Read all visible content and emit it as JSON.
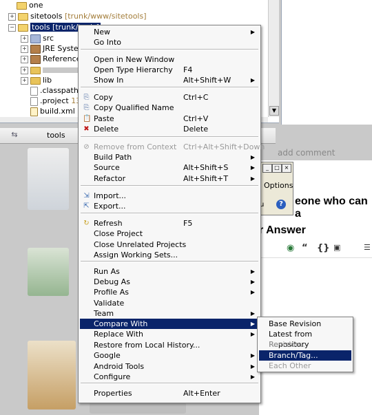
{
  "explorer": {
    "rows": [
      {
        "label": "one",
        "decor": ""
      },
      {
        "label": "sitetools",
        "decor": "[trunk/www/sitetools]"
      },
      {
        "label": "tools [trunk/tools]",
        "decor": ""
      },
      {
        "label": "src",
        "decor": ""
      },
      {
        "label": "JRE System",
        "decor": ""
      },
      {
        "label": "Referenced",
        "decor": ""
      },
      {
        "label": "",
        "decor": ""
      },
      {
        "label": "lib",
        "decor": ""
      },
      {
        "label": ".classpath",
        "decor": "1"
      },
      {
        "label": ".project",
        "decor": "132"
      },
      {
        "label": "build.xml",
        "decor": "14"
      }
    ]
  },
  "tabstrip": {
    "tab_label": "tools"
  },
  "web": {
    "add_comment": "add comment",
    "heading1": "eone who can a",
    "heading2": "r Answer",
    "dialog_options": "Options",
    "dialog_u": "u"
  },
  "menu": {
    "items": [
      {
        "label": "New",
        "shortcut": "",
        "submenu": true,
        "icon": ""
      },
      {
        "label": "Go Into",
        "shortcut": "",
        "submenu": false,
        "icon": ""
      },
      {
        "label": "Open in New Window",
        "shortcut": "",
        "submenu": false,
        "icon": ""
      },
      {
        "label": "Open Type Hierarchy",
        "shortcut": "F4",
        "submenu": false,
        "icon": ""
      },
      {
        "label": "Show In",
        "shortcut": "Alt+Shift+W",
        "submenu": true,
        "icon": ""
      },
      {
        "label": "Copy",
        "shortcut": "Ctrl+C",
        "submenu": false,
        "icon": "copy-icon"
      },
      {
        "label": "Copy Qualified Name",
        "shortcut": "",
        "submenu": false,
        "icon": "copy-icon"
      },
      {
        "label": "Paste",
        "shortcut": "Ctrl+V",
        "submenu": false,
        "icon": "paste-icon"
      },
      {
        "label": "Delete",
        "shortcut": "Delete",
        "submenu": false,
        "icon": "delete-icon"
      },
      {
        "label": "Remove from Context",
        "shortcut": "Ctrl+Alt+Shift+Down",
        "submenu": false,
        "icon": "remove-context-icon",
        "disabled": true
      },
      {
        "label": "Build Path",
        "shortcut": "",
        "submenu": true,
        "icon": ""
      },
      {
        "label": "Source",
        "shortcut": "Alt+Shift+S",
        "submenu": true,
        "icon": ""
      },
      {
        "label": "Refactor",
        "shortcut": "Alt+Shift+T",
        "submenu": true,
        "icon": ""
      },
      {
        "label": "Import...",
        "shortcut": "",
        "submenu": false,
        "icon": "import-icon"
      },
      {
        "label": "Export...",
        "shortcut": "",
        "submenu": false,
        "icon": "export-icon"
      },
      {
        "label": "Refresh",
        "shortcut": "F5",
        "submenu": false,
        "icon": "refresh-icon"
      },
      {
        "label": "Close Project",
        "shortcut": "",
        "submenu": false,
        "icon": ""
      },
      {
        "label": "Close Unrelated Projects",
        "shortcut": "",
        "submenu": false,
        "icon": ""
      },
      {
        "label": "Assign Working Sets...",
        "shortcut": "",
        "submenu": false,
        "icon": ""
      },
      {
        "label": "Run As",
        "shortcut": "",
        "submenu": true,
        "icon": ""
      },
      {
        "label": "Debug As",
        "shortcut": "",
        "submenu": true,
        "icon": ""
      },
      {
        "label": "Profile As",
        "shortcut": "",
        "submenu": true,
        "icon": ""
      },
      {
        "label": "Validate",
        "shortcut": "",
        "submenu": false,
        "icon": ""
      },
      {
        "label": "Team",
        "shortcut": "",
        "submenu": true,
        "icon": ""
      },
      {
        "label": "Compare With",
        "shortcut": "",
        "submenu": true,
        "icon": "",
        "highlighted": true
      },
      {
        "label": "Replace With",
        "shortcut": "",
        "submenu": true,
        "icon": ""
      },
      {
        "label": "Restore from Local History...",
        "shortcut": "",
        "submenu": false,
        "icon": ""
      },
      {
        "label": "Google",
        "shortcut": "",
        "submenu": true,
        "icon": ""
      },
      {
        "label": "Android Tools",
        "shortcut": "",
        "submenu": true,
        "icon": ""
      },
      {
        "label": "Configure",
        "shortcut": "",
        "submenu": true,
        "icon": ""
      },
      {
        "label": "Properties",
        "shortcut": "Alt+Enter",
        "submenu": false,
        "icon": ""
      }
    ]
  },
  "submenu": {
    "items": [
      {
        "label": "Base Revision",
        "disabled": false
      },
      {
        "label": "Latest from Repository",
        "disabled": false
      },
      {
        "label": "Revision...",
        "disabled": true
      },
      {
        "label": "Branch/Tag...",
        "disabled": false,
        "highlighted": true
      },
      {
        "label": "Each Other",
        "disabled": true
      }
    ]
  }
}
